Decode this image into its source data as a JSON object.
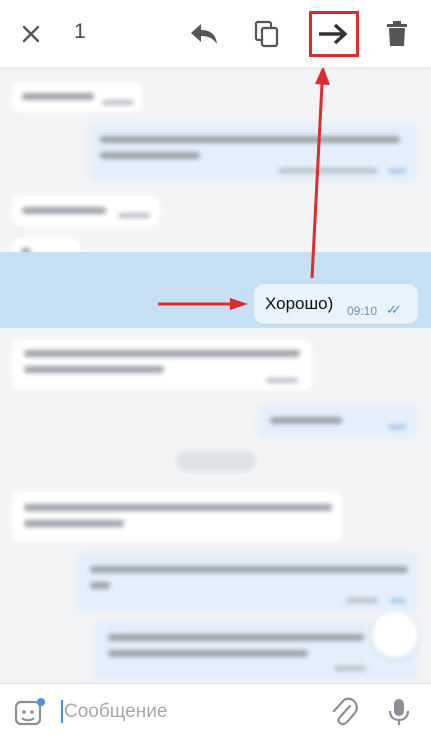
{
  "toolbar": {
    "selected_count": "1",
    "icons": [
      "close-icon",
      "reply-icon",
      "copy-icon",
      "forward-icon",
      "delete-icon"
    ],
    "highlight_color": "#d92e2e"
  },
  "selected_message": {
    "text": "Хорошо)",
    "time": "09:10",
    "status": "✓✓"
  },
  "composer": {
    "placeholder": "Сообщение",
    "icons": [
      "sticker-icon",
      "attach-icon",
      "mic-icon"
    ]
  },
  "colors": {
    "accent": "#4d8fd6",
    "selection": "#c7dff2",
    "outgoing_bubble": "#e9f3fc",
    "annotation": "#d92e2e"
  }
}
